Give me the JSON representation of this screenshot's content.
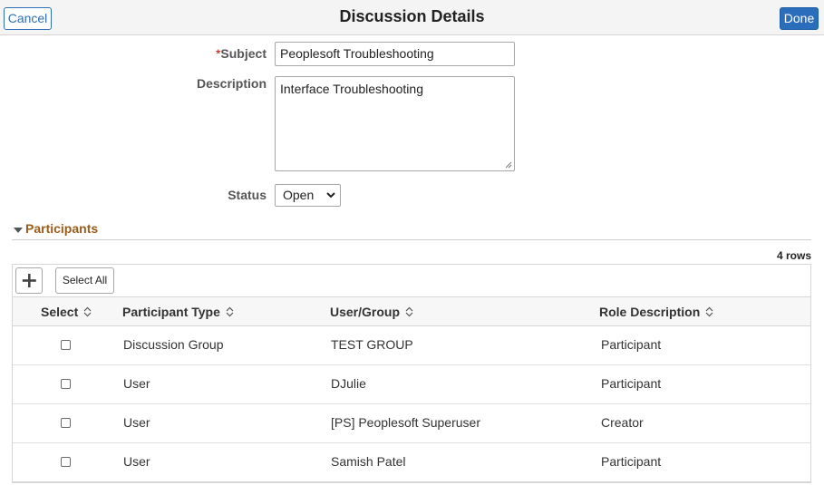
{
  "header": {
    "cancel_label": "Cancel",
    "title": "Discussion Details",
    "done_label": "Done"
  },
  "form": {
    "subject": {
      "required_mark": "*",
      "label": "Subject",
      "value": "Peoplesoft Troubleshooting"
    },
    "description": {
      "label": "Description",
      "value": "Interface Troubleshooting"
    },
    "status": {
      "label": "Status",
      "value": "Open"
    }
  },
  "participants": {
    "section_title": "Participants",
    "row_count": "4 rows",
    "add_icon": "plus-icon",
    "select_all_label": "Select All",
    "columns": [
      "Select",
      "Participant Type",
      "User/Group",
      "Role Description"
    ],
    "rows": [
      {
        "selected": false,
        "type": "Discussion Group",
        "user_group": "TEST GROUP",
        "role": "Participant"
      },
      {
        "selected": false,
        "type": "User",
        "user_group": "DJulie",
        "role": "Participant"
      },
      {
        "selected": false,
        "type": "User",
        "user_group": "[PS] Peoplesoft Superuser",
        "role": "Creator"
      },
      {
        "selected": false,
        "type": "User",
        "user_group": "Samish Patel",
        "role": "Participant"
      }
    ]
  },
  "colors": {
    "accent_blue": "#2a6ebb",
    "section_title": "#9b5b1a"
  }
}
